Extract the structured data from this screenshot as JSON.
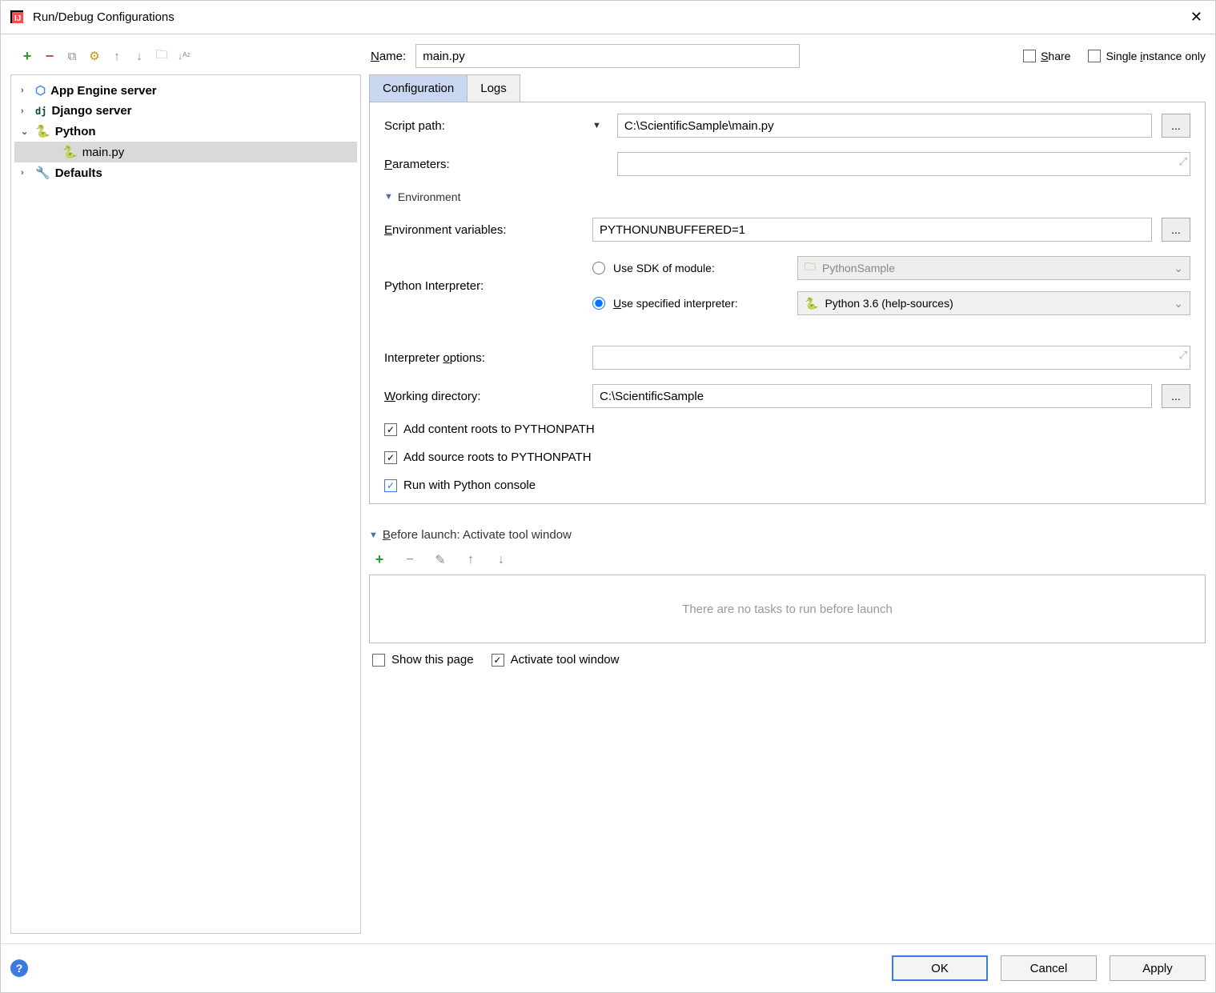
{
  "title": "Run/Debug Configurations",
  "toolbar_left": {
    "add": "+",
    "remove": "−",
    "copy": "⧉",
    "settings": "⚙",
    "up": "↑",
    "down": "↓",
    "folder": "🗀",
    "sort": "↓ᴬᶻ"
  },
  "name_label": "Name:",
  "name_value": "main.py",
  "share_label": "Share",
  "share_checked": false,
  "single_instance_label": "Single instance only",
  "single_instance_checked": false,
  "tree": [
    {
      "label": "App Engine server",
      "bold": true,
      "expander": "›",
      "icon": "cloud-icon"
    },
    {
      "label": "Django server",
      "bold": true,
      "expander": "›",
      "icon": "django-icon"
    },
    {
      "label": "Python",
      "bold": true,
      "expander": "⌄",
      "icon": "python-icon"
    },
    {
      "label": "main.py",
      "bold": false,
      "expander": "",
      "icon": "python-file-icon",
      "indent": true,
      "selected": true
    },
    {
      "label": "Defaults",
      "bold": true,
      "expander": "›",
      "icon": "wrench-icon"
    }
  ],
  "tabs": {
    "config": "Configuration",
    "logs": "Logs"
  },
  "form": {
    "script_path_label": "Script path:",
    "script_path_value": "C:\\ScientificSample\\main.py",
    "parameters_label": "Parameters:",
    "parameters_value": "",
    "env_section": "Environment",
    "env_vars_label": "Environment variables:",
    "env_vars_value": "PYTHONUNBUFFERED=1",
    "python_interp_label": "Python Interpreter:",
    "radio_sdk_label": "Use SDK of module:",
    "sdk_module_value": "PythonSample",
    "radio_specified_label": "Use specified interpreter:",
    "specified_value": "Python 3.6 (help-sources)",
    "interp_options_label": "Interpreter options:",
    "interp_options_value": "",
    "working_dir_label": "Working directory:",
    "working_dir_value": "C:\\ScientificSample",
    "content_roots_label": "Add content roots to PYTHONPATH",
    "content_roots_checked": true,
    "source_roots_label": "Add source roots to PYTHONPATH",
    "source_roots_checked": true,
    "run_console_label": "Run with Python console",
    "run_console_checked": true
  },
  "before_launch": {
    "header": "Before launch: Activate tool window",
    "empty_text": "There are no tasks to run before launch",
    "show_page_label": "Show this page",
    "show_page_checked": false,
    "activate_tool_label": "Activate tool window",
    "activate_tool_checked": true
  },
  "footer": {
    "ok": "OK",
    "cancel": "Cancel",
    "apply": "Apply"
  },
  "ellipsis": "..."
}
